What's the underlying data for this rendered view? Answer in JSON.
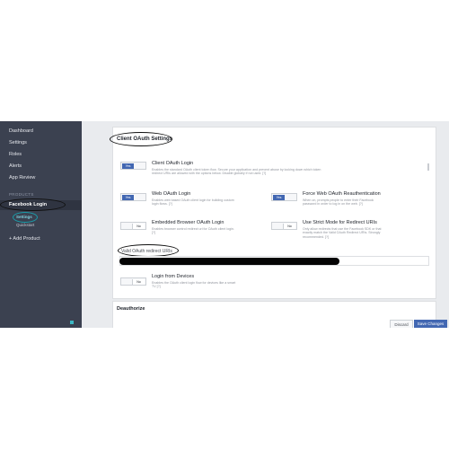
{
  "sidebar": {
    "items": [
      {
        "label": "Dashboard"
      },
      {
        "label": "Settings"
      },
      {
        "label": "Roles"
      },
      {
        "label": "Alerts"
      },
      {
        "label": "App Review"
      }
    ],
    "section_heading": "PRODUCTS",
    "product": "Facebook Login",
    "sub_items": [
      {
        "label": "Settings"
      },
      {
        "label": "Quickstart"
      }
    ],
    "add_product": "+ Add Product"
  },
  "client_oauth": {
    "title": "Client OAuth Settings",
    "options": [
      {
        "title": "Client OAuth Login",
        "state": "Yes",
        "desc": "Enables the standard OAuth client token flow. Secure your application and prevent abuse by locking down which token redirect URIs are allowed with the options below. Disable globally if not used. [?]"
      },
      {
        "title": "Web OAuth Login",
        "state": "Yes",
        "desc": "Enables web based OAuth client login for building custom login flows. [?]"
      },
      {
        "title": "Force Web OAuth Reauthentication",
        "state": "Yes",
        "desc": "When on, prompts people to enter their Facebook password in order to log in on the web. [?]"
      },
      {
        "title": "Embedded Browser OAuth Login",
        "state": "No",
        "desc": "Enables browser control redirect uri for OAuth client login. [?]"
      },
      {
        "title": "Use Strict Mode for Redirect URIs",
        "state": "No",
        "desc": "Only allow redirects that use the Facebook SDK or that exactly match the Valid OAuth Redirect URIs. Strongly recommended. [?]"
      },
      {
        "title": "Login from Devices",
        "state": "No",
        "desc": "Enables the OAuth client login flow for devices like a smart TV [?]"
      }
    ],
    "redirect_label": "Valid OAuth redirect URIs"
  },
  "deauthorize": {
    "title": "Deauthorize"
  },
  "actions": {
    "discard": "Discard",
    "save": "Save Changes"
  },
  "colors": {
    "sidebar": "#3b4150",
    "accent": "#4267b2",
    "annotation": "#111111"
  }
}
